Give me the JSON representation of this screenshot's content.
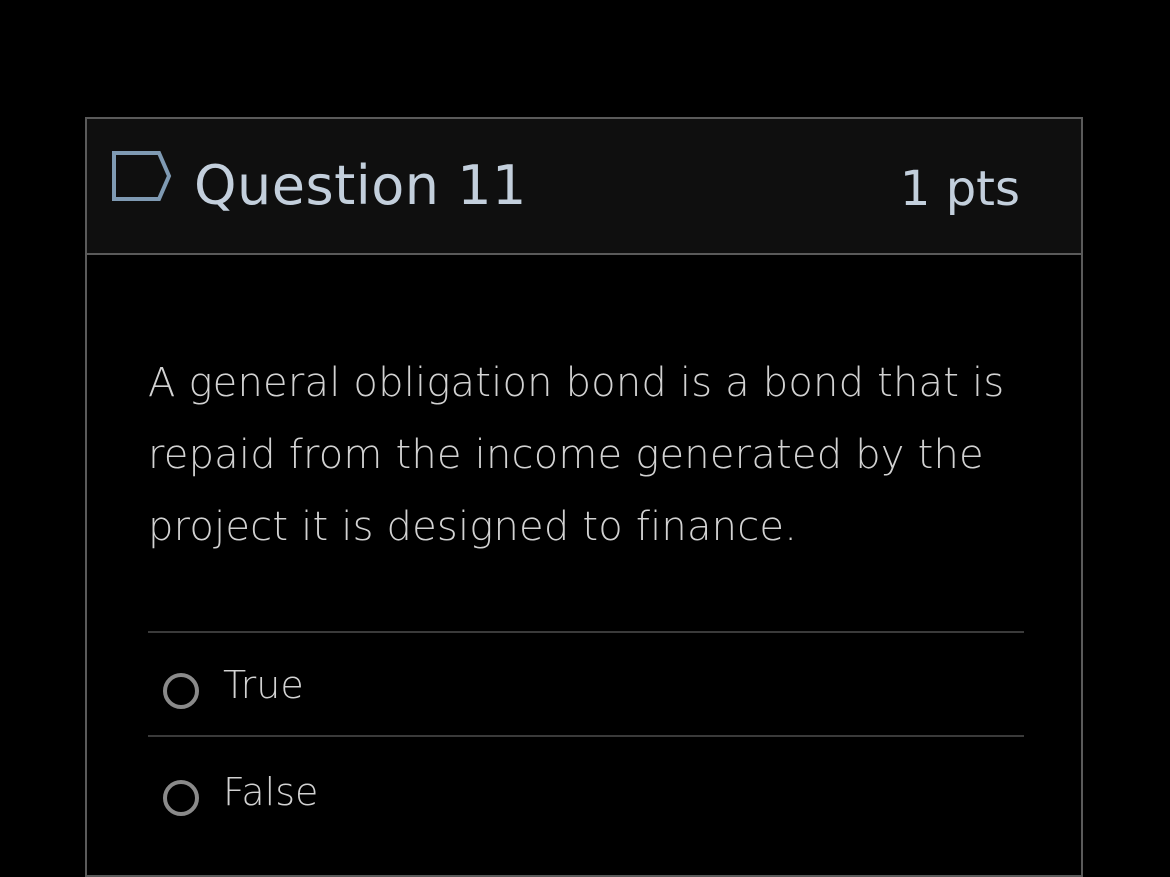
{
  "question": {
    "title": "Question 11",
    "points": "1 pts",
    "flag_icon": "flag-outline-icon",
    "text": "A general obligation bond is a bond that is repaid from the income generated by the project it is designed to finance."
  },
  "answers": [
    {
      "label": "True",
      "selected": false
    },
    {
      "label": "False",
      "selected": false
    }
  ],
  "colors": {
    "background": "#000000",
    "header_background": "#0f0f0f",
    "border": "#5a5a5a",
    "title_text": "#c3cfdc",
    "body_text": "#d2d2d2",
    "radio_border": "#8a8a8a",
    "flag_stroke": "#7f9ab3"
  }
}
